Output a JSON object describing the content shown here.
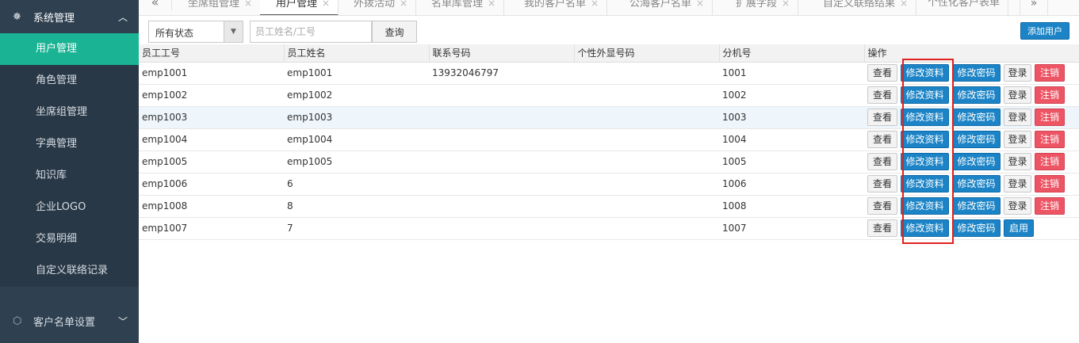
{
  "sidebar": {
    "section1": {
      "label": "系统管理",
      "icon": "gear-icon"
    },
    "items": [
      {
        "label": "用户管理",
        "active": true
      },
      {
        "label": "角色管理"
      },
      {
        "label": "坐席组管理"
      },
      {
        "label": "字典管理"
      },
      {
        "label": "知识库"
      },
      {
        "label": "企业LOGO"
      },
      {
        "label": "交易明细"
      },
      {
        "label": "自定义联络记录"
      }
    ],
    "section2": {
      "label": "客户名单设置",
      "icon": "cube-icon"
    }
  },
  "tabs": [
    {
      "label": "坐席组管理"
    },
    {
      "label": "用户管理",
      "active": true
    },
    {
      "label": "外拨活动"
    },
    {
      "label": "名单库管理"
    },
    {
      "label": "我的客户名单"
    },
    {
      "label": "公海客户名单"
    },
    {
      "label": "扩展字段"
    },
    {
      "label": "自定义联络结果"
    },
    {
      "label": "个性化客户表单"
    }
  ],
  "toolbar": {
    "status_value": "所有状态",
    "name_placeholder": "员工姓名/工号",
    "query_label": "查询",
    "add_user_label": "添加用户"
  },
  "table": {
    "headers": [
      "员工工号",
      "员工姓名",
      "联系号码",
      "个性外显号码",
      "分机号",
      "操作"
    ],
    "rows": [
      {
        "id": "emp1001",
        "name": "emp1001",
        "phone": "13932046797",
        "display": "",
        "ext": "1001",
        "status": "active"
      },
      {
        "id": "emp1002",
        "name": "emp1002",
        "phone": "",
        "display": "",
        "ext": "1002",
        "status": "active"
      },
      {
        "id": "emp1003",
        "name": "emp1003",
        "phone": "",
        "display": "",
        "ext": "1003",
        "status": "active"
      },
      {
        "id": "emp1004",
        "name": "emp1004",
        "phone": "",
        "display": "",
        "ext": "1004",
        "status": "active"
      },
      {
        "id": "emp1005",
        "name": "emp1005",
        "phone": "",
        "display": "",
        "ext": "1005",
        "status": "active"
      },
      {
        "id": "emp1006",
        "name": "6",
        "phone": "",
        "display": "",
        "ext": "1006",
        "status": "active"
      },
      {
        "id": "emp1008",
        "name": "8",
        "phone": "",
        "display": "",
        "ext": "1008",
        "status": "active"
      },
      {
        "id": "emp1007",
        "name": "7",
        "phone": "",
        "display": "",
        "ext": "1007",
        "status": "disabled"
      }
    ],
    "highlighted_row": 2,
    "ops": {
      "view": "查看",
      "edit": "修改资料",
      "password": "修改密码",
      "login": "登录",
      "cancel": "注销",
      "enable": "启用"
    }
  },
  "colors": {
    "sidebar_bg": "#2f4050",
    "active_item": "#1ab394",
    "primary_btn": "#1c84c6",
    "danger_btn": "#ed5565",
    "highlight_box": "#e0201e"
  }
}
